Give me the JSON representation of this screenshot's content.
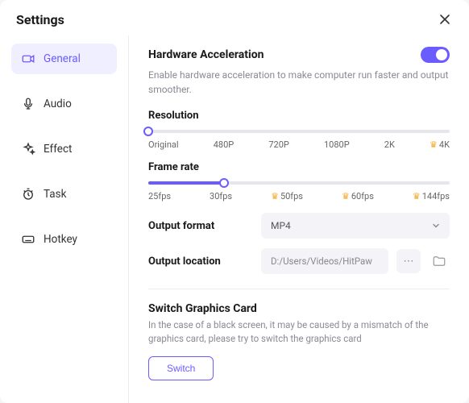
{
  "window": {
    "title": "Settings"
  },
  "sidebar": {
    "items": [
      {
        "label": "General",
        "icon": "camera-icon",
        "active": true
      },
      {
        "label": "Audio",
        "icon": "microphone-icon",
        "active": false
      },
      {
        "label": "Effect",
        "icon": "sparkle-icon",
        "active": false
      },
      {
        "label": "Task",
        "icon": "clock-icon",
        "active": false
      },
      {
        "label": "Hotkey",
        "icon": "keyboard-icon",
        "active": false
      }
    ]
  },
  "general": {
    "hardware_accel": {
      "title": "Hardware Acceleration",
      "enabled": true,
      "description": "Enable hardware acceleration to make computer run faster and output smoother."
    },
    "resolution": {
      "title": "Resolution",
      "value_index": 0,
      "options": [
        {
          "label": "Original",
          "premium": false
        },
        {
          "label": "480P",
          "premium": false
        },
        {
          "label": "720P",
          "premium": false
        },
        {
          "label": "1080P",
          "premium": false
        },
        {
          "label": "2K",
          "premium": false
        },
        {
          "label": "4K",
          "premium": true
        }
      ]
    },
    "frame_rate": {
      "title": "Frame rate",
      "value_index": 1,
      "options": [
        {
          "label": "25fps",
          "premium": false
        },
        {
          "label": "30fps",
          "premium": false
        },
        {
          "label": "50fps",
          "premium": true
        },
        {
          "label": "60fps",
          "premium": true
        },
        {
          "label": "144fps",
          "premium": true
        }
      ]
    },
    "output_format": {
      "label": "Output format",
      "value": "MP4"
    },
    "output_location": {
      "label": "Output location",
      "value": "D:/Users/Videos/HitPaw"
    },
    "graphics_card": {
      "title": "Switch Graphics Card",
      "description": "In the case of a black screen, it may be caused by a mismatch of the graphics card, please try to switch the graphics card",
      "button": "Switch"
    }
  }
}
